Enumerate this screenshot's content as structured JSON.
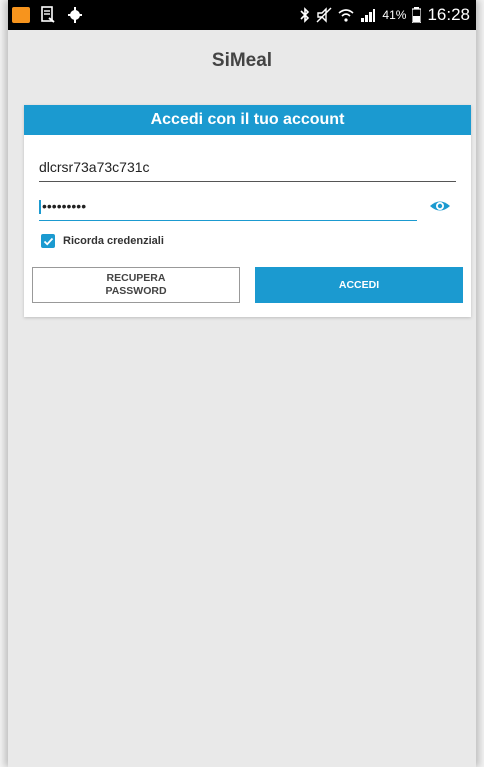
{
  "status_bar": {
    "time": "16:28",
    "battery": "41%"
  },
  "app": {
    "title": "SiMeal"
  },
  "login_card": {
    "header": "Accedi con il tuo account",
    "username_value": "dlcrsr73a73c731c",
    "password_value": "•••••••••",
    "remember_label": "Ricorda credenziali",
    "remember_checked": true,
    "recover_label_line1": "RECUPERA",
    "recover_label_line2": "PASSWORD",
    "login_label": "ACCEDI"
  },
  "colors": {
    "accent": "#1b9ad0",
    "background": "#e9e9e9",
    "status_bar": "#000000"
  },
  "icons": [
    "app-notification-icon",
    "document-icon",
    "android-debug-icon",
    "bluetooth-icon",
    "mute-icon",
    "wifi-icon",
    "signal-icon",
    "battery-icon",
    "eye-icon",
    "check-icon"
  ]
}
